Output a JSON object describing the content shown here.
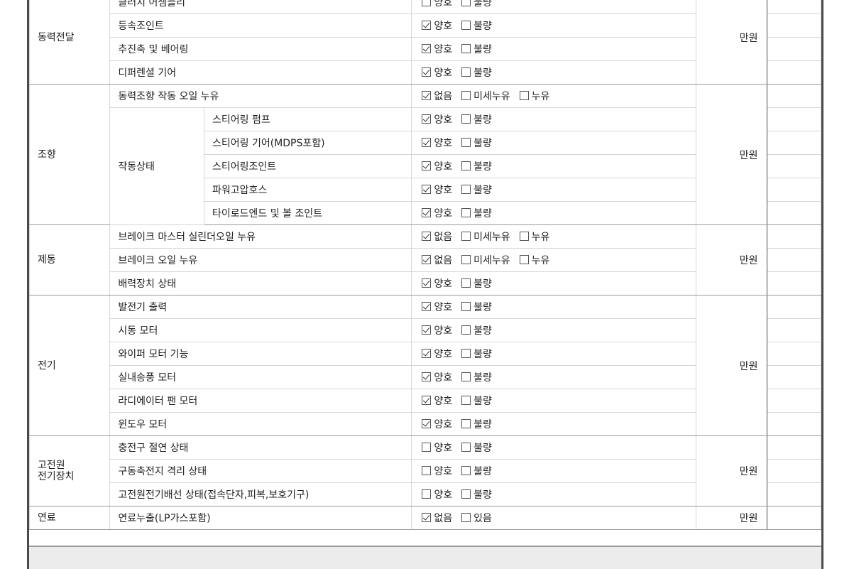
{
  "groups": [
    {
      "category": "동력전달",
      "amount_label": "만원",
      "rows": [
        {
          "item": "클러치 어셈블리",
          "options": [
            {
              "label": "양호",
              "checked": false
            },
            {
              "label": "불량",
              "checked": false
            }
          ]
        },
        {
          "item": "등속조인트",
          "options": [
            {
              "label": "양호",
              "checked": true
            },
            {
              "label": "불량",
              "checked": false
            }
          ]
        },
        {
          "item": "추진축 및 베어링",
          "options": [
            {
              "label": "양호",
              "checked": true
            },
            {
              "label": "불량",
              "checked": false
            }
          ]
        },
        {
          "item": "디퍼렌셜 기어",
          "options": [
            {
              "label": "양호",
              "checked": true
            },
            {
              "label": "불량",
              "checked": false
            }
          ]
        }
      ]
    },
    {
      "category": "조향",
      "amount_label": "만원",
      "rows": [
        {
          "item": "동력조향 작동 오일 누유",
          "options": [
            {
              "label": "없음",
              "checked": true
            },
            {
              "label": "미세누유",
              "checked": false
            },
            {
              "label": "누유",
              "checked": false
            }
          ]
        },
        {
          "item": "스티어링 펌프",
          "options": [
            {
              "label": "양호",
              "checked": true
            },
            {
              "label": "불량",
              "checked": false
            }
          ]
        },
        {
          "item": "스티어링 기어(MDPS포함)",
          "options": [
            {
              "label": "양호",
              "checked": true
            },
            {
              "label": "불량",
              "checked": false
            }
          ]
        },
        {
          "item": "스티어링조인트",
          "options": [
            {
              "label": "양호",
              "checked": true
            },
            {
              "label": "불량",
              "checked": false
            }
          ]
        },
        {
          "item": "파워고압호스",
          "options": [
            {
              "label": "양호",
              "checked": true
            },
            {
              "label": "불량",
              "checked": false
            }
          ]
        },
        {
          "item": "타이로드엔드 및 볼 조인트",
          "options": [
            {
              "label": "양호",
              "checked": true
            },
            {
              "label": "불량",
              "checked": false
            }
          ]
        }
      ],
      "sub_category": "작동상태"
    },
    {
      "category": "제동",
      "amount_label": "만원",
      "rows": [
        {
          "item": "브레이크 마스터 실린더오일 누유",
          "options": [
            {
              "label": "없음",
              "checked": true
            },
            {
              "label": "미세누유",
              "checked": false
            },
            {
              "label": "누유",
              "checked": false
            }
          ]
        },
        {
          "item": "브레이크 오일 누유",
          "options": [
            {
              "label": "없음",
              "checked": true
            },
            {
              "label": "미세누유",
              "checked": false
            },
            {
              "label": "누유",
              "checked": false
            }
          ]
        },
        {
          "item": "배력장치 상태",
          "options": [
            {
              "label": "양호",
              "checked": true
            },
            {
              "label": "불량",
              "checked": false
            }
          ]
        }
      ]
    },
    {
      "category": "전기",
      "amount_label": "만원",
      "rows": [
        {
          "item": "발전기 출력",
          "options": [
            {
              "label": "양호",
              "checked": true
            },
            {
              "label": "불량",
              "checked": false
            }
          ]
        },
        {
          "item": "시동 모터",
          "options": [
            {
              "label": "양호",
              "checked": true
            },
            {
              "label": "불량",
              "checked": false
            }
          ]
        },
        {
          "item": "와이퍼 모터 기능",
          "options": [
            {
              "label": "양호",
              "checked": true
            },
            {
              "label": "불량",
              "checked": false
            }
          ]
        },
        {
          "item": "실내송풍 모터",
          "options": [
            {
              "label": "양호",
              "checked": true
            },
            {
              "label": "불량",
              "checked": false
            }
          ]
        },
        {
          "item": "라디에이터 팬 모터",
          "options": [
            {
              "label": "양호",
              "checked": true
            },
            {
              "label": "불량",
              "checked": false
            }
          ]
        },
        {
          "item": "윈도우 모터",
          "options": [
            {
              "label": "양호",
              "checked": true
            },
            {
              "label": "불량",
              "checked": false
            }
          ]
        }
      ]
    },
    {
      "category_lines": [
        "고전원",
        "전기장치"
      ],
      "amount_label": "만원",
      "rows": [
        {
          "item": "충전구 절연 상태",
          "options": [
            {
              "label": "양호",
              "checked": false
            },
            {
              "label": "불량",
              "checked": false
            }
          ]
        },
        {
          "item": "구동축전지 격리 상태",
          "options": [
            {
              "label": "양호",
              "checked": false
            },
            {
              "label": "불량",
              "checked": false
            }
          ]
        },
        {
          "item": "고전원전기배선 상태(접속단자,피복,보호기구)",
          "options": [
            {
              "label": "양호",
              "checked": false
            },
            {
              "label": "불량",
              "checked": false
            }
          ]
        }
      ]
    },
    {
      "category": "연료",
      "amount_label": "만원",
      "rows": [
        {
          "item": "연료누출(LP가스포함)",
          "options": [
            {
              "label": "없음",
              "checked": true
            },
            {
              "label": "있음",
              "checked": false
            }
          ]
        }
      ]
    }
  ]
}
